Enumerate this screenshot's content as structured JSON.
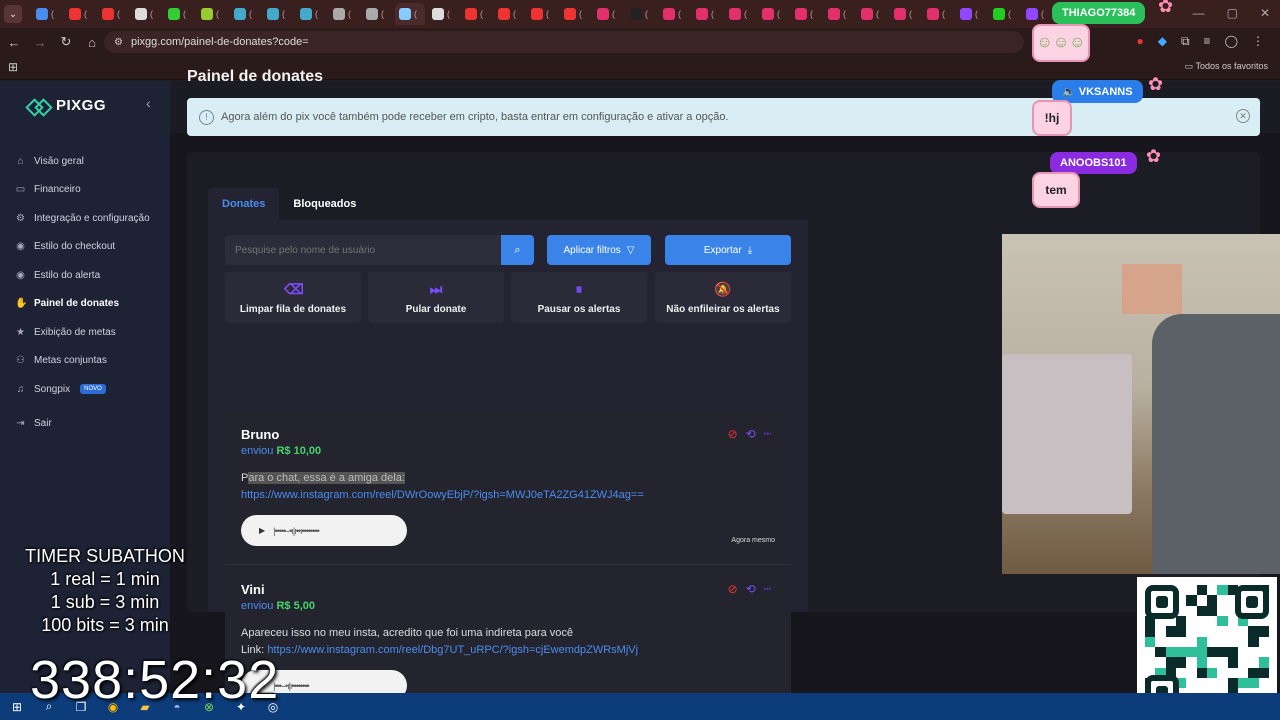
{
  "browser": {
    "url": "pixgg.com/painel-de-donates?code=",
    "bookmarks_label": "Todos os favoritos",
    "tab_colors": [
      "#4a8df0",
      "#e33",
      "#e33",
      "#ddd",
      "#3c3",
      "#9c3",
      "#4ac",
      "#4ac",
      "#4ac",
      "#aaa",
      "#aaa",
      "#8cf",
      "#ddd",
      "#e33",
      "#e33",
      "#e33",
      "#e33",
      "#e1306c",
      "#222",
      "#e1306c",
      "#e1306c",
      "#e1306c",
      "#e1306c",
      "#e1306c",
      "#e1306c",
      "#e1306c",
      "#e1306c",
      "#e1306c",
      "#9146ff",
      "#2c2",
      "#9146ff"
    ]
  },
  "sidebar": {
    "brand": "PIXGG",
    "items": [
      {
        "label": "Visão geral",
        "icon": "home-icon",
        "glyph": "⌂"
      },
      {
        "label": "Financeiro",
        "icon": "wallet-icon",
        "glyph": "▭"
      },
      {
        "label": "Integração e configuração",
        "icon": "gear-icon",
        "glyph": "⚙"
      },
      {
        "label": "Estilo do checkout",
        "icon": "palette-icon",
        "glyph": "◉"
      },
      {
        "label": "Estilo do alerta",
        "icon": "palette-icon",
        "glyph": "◉"
      },
      {
        "label": "Painel de donates",
        "icon": "hand-coin-icon",
        "glyph": "✋"
      },
      {
        "label": "Exibição de metas",
        "icon": "star-icon",
        "glyph": "★"
      },
      {
        "label": "Metas conjuntas",
        "icon": "group-icon",
        "glyph": "⚇"
      },
      {
        "label": "Songpix",
        "icon": "music-icon",
        "glyph": "♫",
        "badge": "NOVO"
      },
      {
        "label": "Sair",
        "icon": "logout-icon",
        "glyph": "⇥"
      }
    ]
  },
  "main": {
    "title": "Painel de donates",
    "banner": "Agora além do pix você também pode receber em cripto, basta entrar em configuração e ativar a opção.",
    "tabs": [
      "Donates",
      "Bloqueados"
    ],
    "search_placeholder": "Pesquise pelo nome de usuário",
    "filter_label": "Aplicar filtros",
    "export_label": "Exportar",
    "actions": [
      {
        "label": "Limpar fila de donates",
        "icon": "eraser-icon",
        "glyph": "⌫"
      },
      {
        "label": "Pular donate",
        "icon": "skip-icon",
        "glyph": "⏭"
      },
      {
        "label": "Pausar os alertas",
        "icon": "pause-icon",
        "glyph": "⏸"
      },
      {
        "label": "Não enfileirar os alertas",
        "icon": "bell-off-icon",
        "glyph": "🔕"
      }
    ],
    "donates": [
      {
        "name": "Bruno",
        "sent_prefix": "enviou",
        "amount": "R$ 10,00",
        "msg_start": "P",
        "msg_highlight": "ara o chat, essa é a amiga dela:",
        "link": "https://www.instagram.com/reel/DWrOowyEbjP/?igsh=MWJ0eTA2ZG41ZWJ4ag==",
        "time": "Agora mesmo"
      },
      {
        "name": "Vini",
        "sent_prefix": "enviou",
        "amount": "R$ 5,00",
        "message": "Apareceu isso no meu insta, acredito que foi uma indireta para você",
        "link_prefix": "Link:",
        "link": "https://www.instagram.com/reel/Dbg7UT_uRPC/?igsh=cjEwemdpZWRsMjVj"
      }
    ]
  },
  "stream": {
    "timer_lines": [
      "TIMER SUBATHON",
      "1 real = 1 min",
      "1 sub = 3 min",
      "100 bits = 3 min"
    ],
    "countdown": "338:52:32",
    "chat": [
      {
        "user": "THIAGO77384",
        "message": "",
        "color": "#2bbf5c"
      },
      {
        "user": "VKSANNS",
        "message": "!hj",
        "color": "#2b7de9"
      },
      {
        "user": "ANOOBS101",
        "message": "tem",
        "color": "#8a2be2"
      }
    ]
  }
}
